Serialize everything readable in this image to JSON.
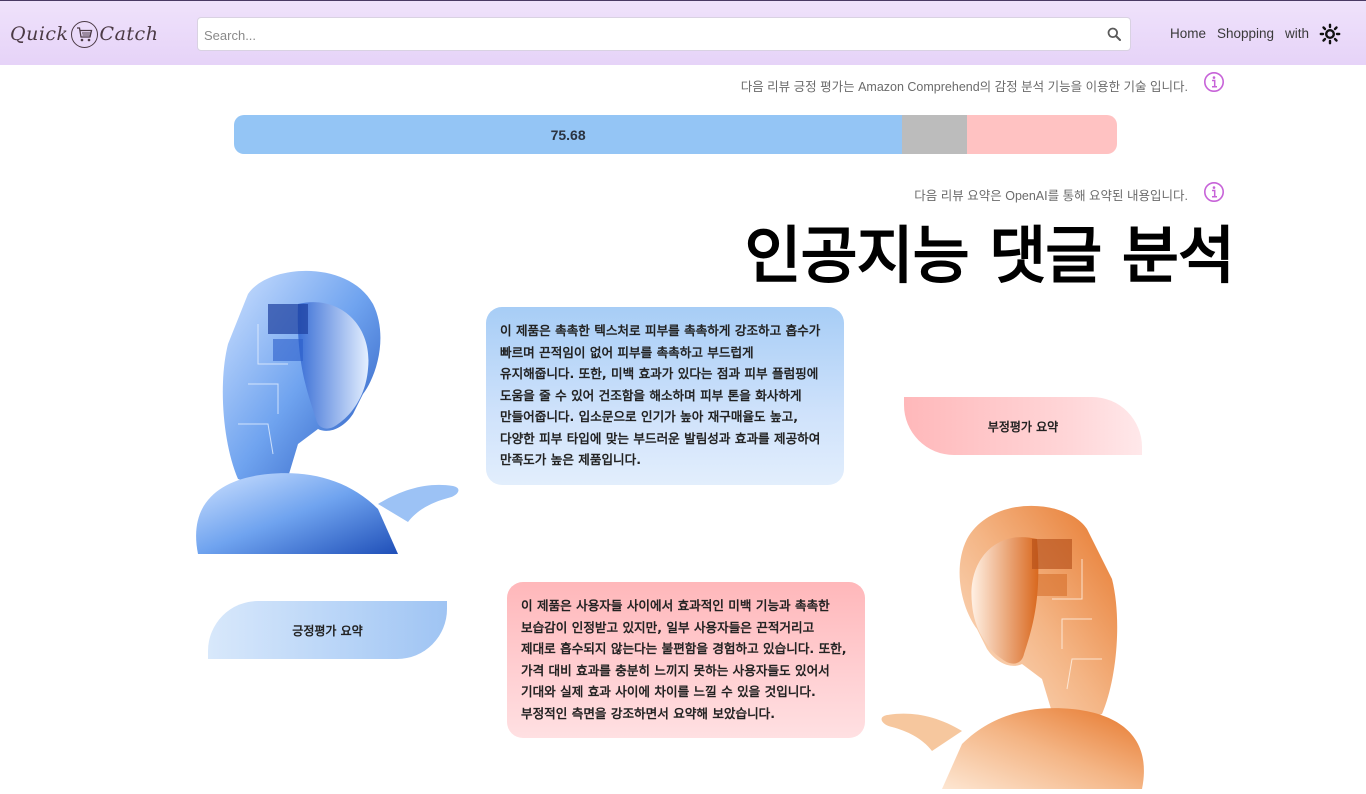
{
  "header": {
    "logo_left": "Quick",
    "logo_right": "Catch",
    "search_placeholder": "Search...",
    "nav": [
      "Home",
      "Shopping",
      "with"
    ]
  },
  "sentiment_note": "다음 리뷰 긍정 평가는 Amazon Comprehend의 감정 분석 기능을 이용한 기술 입니다.",
  "sentiment_bar": {
    "positive_label": "75.68",
    "positive": 75.68,
    "neutral": 7.3,
    "negative": 17.02,
    "colors": {
      "positive": "#94c5f5",
      "neutral": "#bcbcbc",
      "negative": "#ffc2c2"
    }
  },
  "summary_note": "다음 리뷰 요약은 OpenAI를 통해 요약된 내용입니다.",
  "title": "인공지능 댓글 분석",
  "positive_summary": {
    "text": "이 제품은 촉촉한 텍스처로 피부를 촉촉하게 강조하고 흡수가 빠르며 끈적임이 없어 피부를 촉촉하고 부드럽게 유지해줍니다. 또한, 미백 효과가 있다는 점과 피부 플럼핑에 도움을 줄 수 있어 건조함을 해소하며 피부 톤을 화사하게 만들어줍니다. 입소문으로 인기가 높아 재구매율도 높고, 다양한 피부 타입에 맞는 부드러운 발림성과 효과를 제공하여 만족도가 높은 제품입니다.",
    "tag": "긍정평가 요약"
  },
  "negative_summary": {
    "text": "이 제품은 사용자들 사이에서 효과적인 미백 기능과 촉촉한 보습감이 인정받고 있지만, 일부 사용자들은 끈적거리고 제대로 흡수되지 않는다는 불편함을 경험하고 있습니다. 또한, 가격 대비 효과를 충분히 느끼지 못하는 사용자들도 있어서 기대와 실제 효과 사이에 차이를 느낄 수 있을 것입니다. 부정적인 측면을 강조하면서 요약해 보았습니다.",
    "tag": "부정평가 요약"
  },
  "icons": [
    "cart-icon",
    "search-icon",
    "sun-icon",
    "info-icon",
    "robot-image-blue",
    "robot-image-orange"
  ]
}
